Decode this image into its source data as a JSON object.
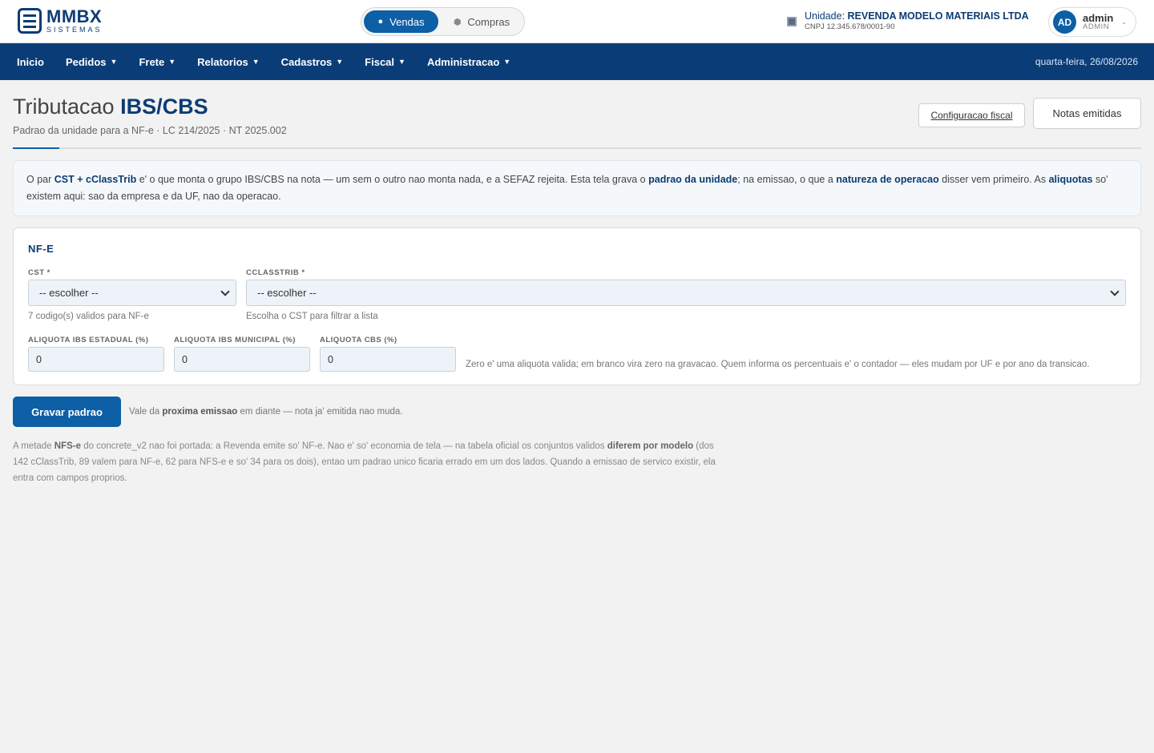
{
  "brand": {
    "name": "MMBX",
    "sub": "SISTEMAS"
  },
  "mode": {
    "active": "Vendas",
    "inactive": "Compras"
  },
  "unit": {
    "prefix": "Unidade: ",
    "name": "REVENDA MODELO MATERIAIS LTDA",
    "cnpj": "CNPJ 12.345.678/0001-90"
  },
  "user": {
    "initials": "AD",
    "name": "admin",
    "role": "ADMIN"
  },
  "nav": {
    "items": [
      {
        "label": "Inicio",
        "caret": ""
      },
      {
        "label": "Pedidos",
        "caret": "▼"
      },
      {
        "label": "Frete",
        "caret": "▼"
      },
      {
        "label": "Relatorios",
        "caret": "▼"
      },
      {
        "label": "Cadastros",
        "caret": "▼"
      },
      {
        "label": "Fiscal",
        "caret": "▼"
      },
      {
        "label": "Administracao",
        "caret": "▼"
      }
    ],
    "date": "quarta-feira, 26/08/2026"
  },
  "page": {
    "title_light": "Tributacao ",
    "title_bold": "IBS/CBS",
    "subtitle": "Padrao da unidade para a NF-e · LC 214/2025 · NT 2025.002",
    "btn_config": "Configuracao fiscal",
    "btn_notas": "Notas emitidas"
  },
  "info": {
    "t1": "O par ",
    "b1": "CST + cClassTrib",
    "t2": " e' o que monta o grupo IBS/CBS na nota — um sem o outro nao monta nada, e a SEFAZ rejeita. Esta tela grava o ",
    "b2": "padrao da unidade",
    "t3": "; na emissao, o que a ",
    "b3": "natureza de operacao",
    "t4": " disser vem primeiro. As ",
    "b4": "aliquotas",
    "t5": " so' existem aqui: sao da empresa e da UF, nao da operacao."
  },
  "form": {
    "section": "NF-E",
    "cst_label": "CST *",
    "cst_value": "-- escolher --",
    "cst_hint": "7 codigo(s) validos para NF-e",
    "cclass_label": "CCLASSTRIB *",
    "cclass_value": "-- escolher --",
    "cclass_hint": "Escolha o CST para filtrar a lista",
    "ibs_est_label": "ALIQUOTA IBS ESTADUAL (%)",
    "ibs_est_value": "0",
    "ibs_mun_label": "ALIQUOTA IBS MUNICIPAL (%)",
    "ibs_mun_value": "0",
    "cbs_label": "ALIQUOTA CBS (%)",
    "cbs_value": "0",
    "aliq_hint": "Zero e' uma aliquota valida; em branco vira zero na gravacao. Quem informa os percentuais e' o contador — eles mudam por UF e por ano da transicao."
  },
  "actions": {
    "save": "Gravar padrao",
    "note_t1": "Vale da ",
    "note_b1": "proxima emissao",
    "note_t2": " em diante — nota ja' emitida nao muda."
  },
  "footer": {
    "t1": "A metade ",
    "b1": "NFS-e",
    "t2": " do concrete_v2 nao foi portada: a Revenda emite so' NF-e. Nao e' so' economia de tela — na tabela oficial os conjuntos validos ",
    "b2": "diferem por modelo",
    "t3": " (dos 142 cClassTrib, 89 valem para NF-e, 62 para NFS-e e so' 34 para os dois), entao um padrao unico ficaria errado em um dos lados. Quando a emissao de servico existir, ela entra com campos proprios."
  },
  "colors": {
    "primary": "#0d5fa6",
    "navbar": "#0a3d78",
    "brand": "#0d3c73"
  },
  "icons": {
    "vendas": "cart-icon",
    "compras": "box-icon",
    "unit": "building-icon",
    "select": "chevron-down-icon"
  }
}
